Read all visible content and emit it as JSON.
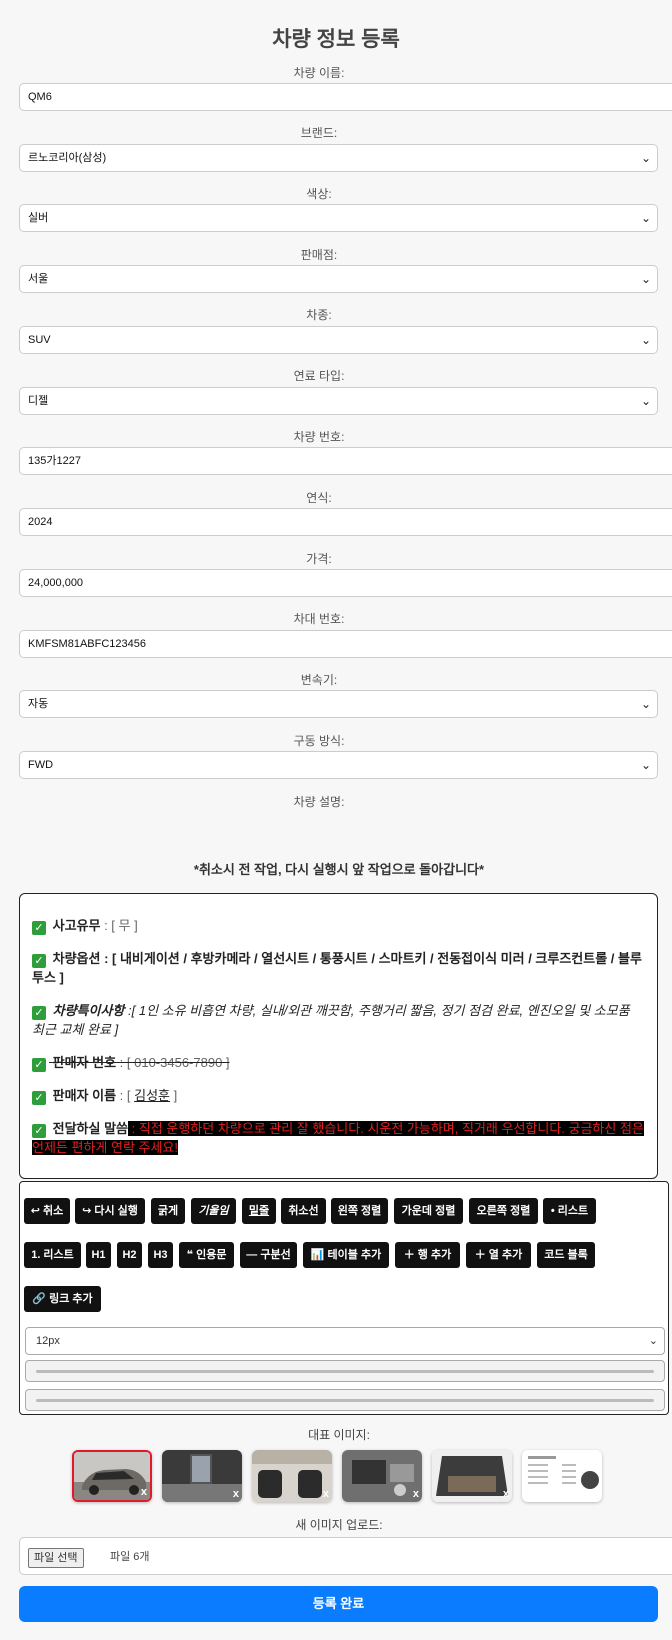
{
  "title": "차량 정보 등록",
  "fields": {
    "name": {
      "label": "차량 이름:",
      "value": "QM6"
    },
    "brand": {
      "label": "브랜드:",
      "value": "르노코리아(삼성)"
    },
    "color": {
      "label": "색상:",
      "value": "실버"
    },
    "dealer": {
      "label": "판매점:",
      "value": "서울"
    },
    "type": {
      "label": "차종:",
      "value": "SUV"
    },
    "fuel": {
      "label": "연료 타입:",
      "value": "디젤"
    },
    "plate": {
      "label": "차량 번호:",
      "value": "135가1227"
    },
    "year": {
      "label": "연식:",
      "value": "2024"
    },
    "price": {
      "label": "가격:",
      "value": "24,000,000"
    },
    "vin": {
      "label": "차대 번호:",
      "value": "KMFSM81ABFC123456"
    },
    "transmission": {
      "label": "변속기:",
      "value": "자동"
    },
    "drive": {
      "label": "구동 방식:",
      "value": "FWD"
    },
    "description": {
      "label": "차량 설명:"
    }
  },
  "notice": "*취소시 전 작업, 다시 실행시 앞 작업으로 돌아갑니다*",
  "editor": {
    "check": "✓",
    "accident_label": "사고유무",
    "accident_value": " : [ 무 ]",
    "options_label": "차량옵션",
    "options_value": " : [ 내비게이션 / 후방카메라 / 열선시트 / 통풍시트 / 스마트키 / 전동접이식 미러 / 크루즈컨트롤 / 블루투스 ]",
    "notes_label": "차량특이사항",
    "notes_value": " :[ 1인 소유 비흡연 차량, 실내/외관 깨끗함, 주행거리 짧음, 정기 점검 완료, 엔진오일 및 소모품 최근 교체 완료 ]",
    "phone_label": "판매자 번호",
    "phone_value": " : [ 010-3456-7890 ]",
    "seller_label": "판매자 이름",
    "seller_prefix": " : [ ",
    "seller_name": "김성훈",
    "seller_suffix": " ]",
    "message_label": "전달하실 말씀",
    "message_value": " : 직접 운행하던 차량으로 관리 잘 했습니다. 시운전 가능하며, 직거래 우선합니다. 궁금하신 점은 언제든 편하게 연락 주세요! "
  },
  "toolbar": {
    "undo": "↩ 취소",
    "redo": "↪ 다시 실행",
    "bold": "굵게",
    "italic": "기울임",
    "underline": "밑줄",
    "strike": "취소선",
    "align_left": "왼쪽 정렬",
    "align_center": "가운데 정렬",
    "align_right": "오른쪽 정렬",
    "bullet_list": "• 리스트",
    "numbered_list": "1. 리스트",
    "h1": "H1",
    "h2": "H2",
    "h3": "H3",
    "quote": "❝ 인용문",
    "divider": "— 구분선",
    "table": "📊 테이블 추가",
    "add_row": "＋ 행 추가",
    "add_col": "＋ 열 추가",
    "code": "코드 블록",
    "link": "🔗 링크 추가",
    "font_size": "12px"
  },
  "images": {
    "label": "대표 이미지:",
    "remove": "x",
    "upload_label": "새 이미지 업로드:",
    "file_button": "파일 선택",
    "file_count": "파일 6개"
  },
  "submit": "등록 완료"
}
